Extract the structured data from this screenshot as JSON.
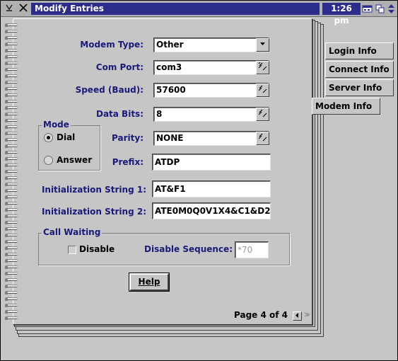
{
  "window": {
    "title": "Modify Entries",
    "clock": "1:26 pm"
  },
  "tabs": [
    {
      "label": "Login Info"
    },
    {
      "label": "Connect Info"
    },
    {
      "label": "Server Info"
    },
    {
      "label": "Modem Info"
    }
  ],
  "form": {
    "modem_type": {
      "label": "Modem Type:",
      "value": "Other"
    },
    "com_port": {
      "label": "Com Port:",
      "value": "com3"
    },
    "speed": {
      "label": "Speed (Baud):",
      "value": "57600"
    },
    "data_bits": {
      "label": "Data Bits:",
      "value": "8"
    },
    "parity": {
      "label": "Parity:",
      "value": "NONE"
    },
    "prefix": {
      "label": "Prefix:",
      "value": "ATDP"
    },
    "init1": {
      "label": "Initialization String 1:",
      "value": "AT&F1"
    },
    "init2": {
      "label": "Initialization String 2:",
      "value": "ATE0M0Q0V1X4&C1&D2"
    }
  },
  "mode": {
    "title": "Mode",
    "options": [
      {
        "label": "Dial",
        "selected": true
      },
      {
        "label": "Answer",
        "selected": false
      }
    ]
  },
  "call_waiting": {
    "title": "Call Waiting",
    "disable_label": "Disable",
    "disable_checked": false,
    "sequence_label": "Disable Sequence:",
    "sequence_value": "*70"
  },
  "help_button": "Help",
  "pager": {
    "text": "Page 4 of 4"
  },
  "icons": [
    "system-menu-icon",
    "close-icon",
    "window-list-icon",
    "restore-icon",
    "up-down-icon",
    "dropdown-arrow-icon",
    "spin-icon",
    "page-prev-icon",
    "page-next-icon"
  ]
}
